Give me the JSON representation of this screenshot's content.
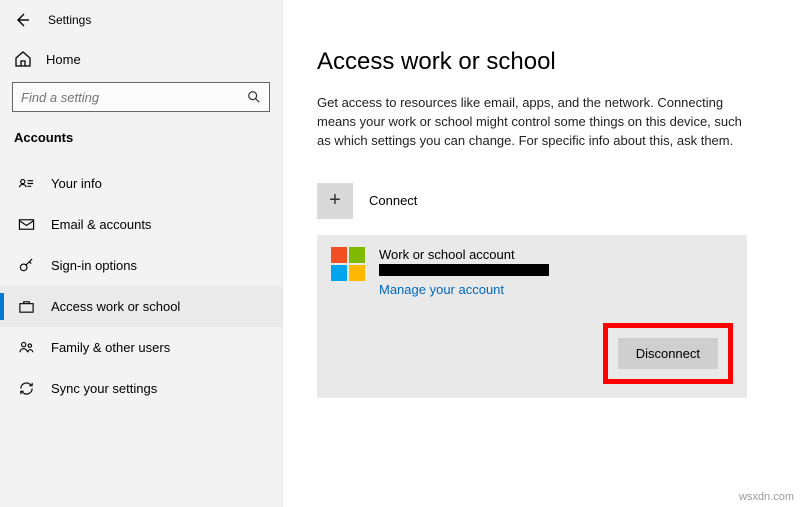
{
  "titlebar": {
    "app_name": "Settings"
  },
  "sidebar": {
    "home_label": "Home",
    "search_placeholder": "Find a setting",
    "category": "Accounts",
    "items": [
      {
        "label": "Your info"
      },
      {
        "label": "Email & accounts"
      },
      {
        "label": "Sign-in options"
      },
      {
        "label": "Access work or school"
      },
      {
        "label": "Family & other users"
      },
      {
        "label": "Sync your settings"
      }
    ]
  },
  "main": {
    "title": "Access work or school",
    "description": "Get access to resources like email, apps, and the network. Connecting means your work or school might control some things on this device, such as which settings you can change. For specific info about this, ask them.",
    "connect_label": "Connect",
    "account": {
      "title": "Work or school account",
      "manage_link": "Manage your account",
      "disconnect_label": "Disconnect"
    }
  },
  "footer": {
    "watermark": "wsxdn.com"
  }
}
